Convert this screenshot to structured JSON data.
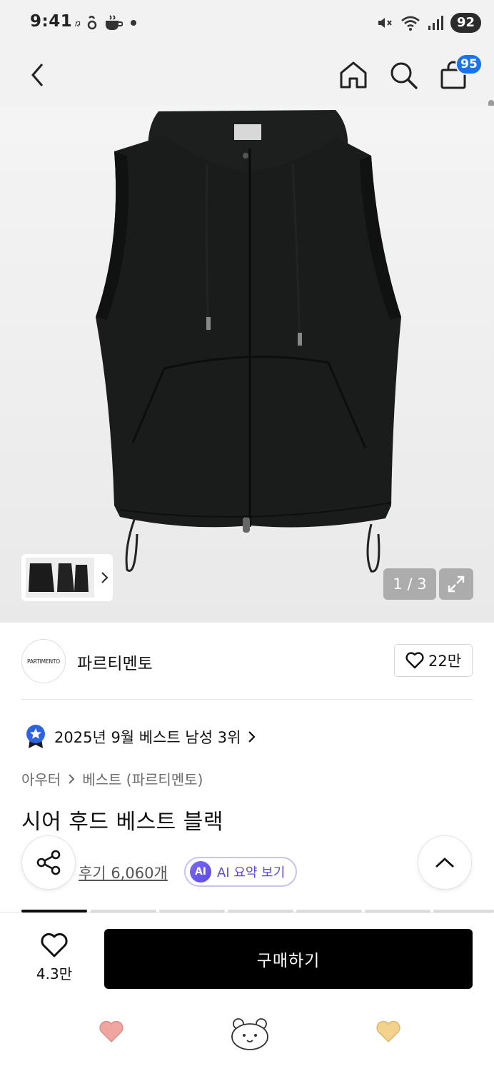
{
  "status_bar": {
    "time": "9:41",
    "battery": "92",
    "icons": [
      "netflix-icon",
      "thread-icon",
      "coffee-icon",
      "dot-icon",
      "mute-icon",
      "wifi-icon",
      "signal-icon"
    ]
  },
  "header": {
    "cart_count": "95"
  },
  "gallery": {
    "page": "1 / 3"
  },
  "brand": {
    "logo_text": "PARTIMENTO",
    "name": "파르티멘토",
    "likes": "22만"
  },
  "ranking": {
    "text": "2025년 9월 베스트 남성 3위"
  },
  "breadcrumb": {
    "category": "아우터",
    "subcategory": "베스트 (파르티멘토)"
  },
  "product": {
    "title": "시어 후드 베스트 블랙"
  },
  "reviews": {
    "link": "후기 6,060개",
    "ai_badge": "AI",
    "ai_label": "AI 요약 보기"
  },
  "bottom_bar": {
    "wish_count": "4.3만",
    "buy_label": "구매하기"
  },
  "colors": {
    "accent_blue": "#1a73e8",
    "ai_purple": "#5b48e0",
    "buy_black": "#000000",
    "heart_pink": "#f0a6a0",
    "heart_yellow": "#f3d28e"
  }
}
